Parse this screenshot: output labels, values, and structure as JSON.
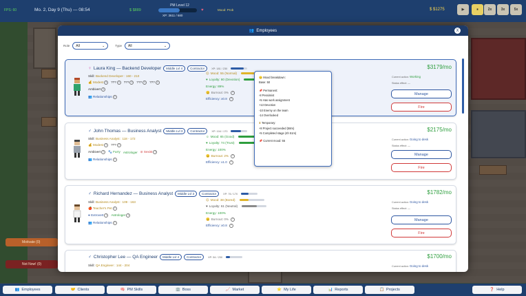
{
  "topbar": {
    "fps": "FPS: 60",
    "date": "Mo. 2, Day 9 (Thu) — 08:54",
    "money_left": "$ $889",
    "pm_level": "PM Level 12",
    "xp": "XP: 3611 / 680",
    "mood_label": "Mood: Prob",
    "balance": "$ $1275",
    "controls": [
      "▶",
      "⏸",
      "2x",
      "3x",
      "5x"
    ]
  },
  "modal": {
    "title": "Employees",
    "close": "X",
    "filters": {
      "role_label": "Role",
      "role_value": "All",
      "type_label": "Type",
      "type_value": "All"
    }
  },
  "employees": [
    {
      "name": "Laura King — Backend Developer",
      "level": "Middle Lvl 4",
      "contract": "Contractor",
      "xp": "XP: 181 / 230",
      "xp_ratio": 0.78,
      "skill_label": "Skill:",
      "skill": "Backend Developer : 160 - 210",
      "traits": [
        "Modest",
        "???",
        "???",
        "???",
        "???"
      ],
      "trait2": "Ambivert",
      "relationships": "Relationships",
      "mood": "Mood: 55 (Normal)",
      "mood_ratio": 0.55,
      "loyalty": "Loyalty: 80 (Devotion)",
      "loyalty_ratio": 0.8,
      "energy": "Energy: 89%",
      "burnout": "Burnout: 0%",
      "efficiency": "Efficiency: x0.8",
      "price": "$3179/mo",
      "current_action_label": "Current action:",
      "current_action": "Working",
      "status_effect": "Status effect: —",
      "manage": "Manage",
      "fire": "Fire"
    },
    {
      "name": "John Thomas — Business Analyst",
      "level": "Middle Lvl 3",
      "contract": "Contractor",
      "xp": "XP: 104 / 170",
      "xp_ratio": 0.61,
      "skill_label": "Skill:",
      "skill": "Business Analyst : 118 - 172",
      "traits": [
        "Modest",
        "???",
        "Furry",
        "Astrologer",
        "Sexist"
      ],
      "trait2": "Ambivert",
      "relationships": "Relationships",
      "mood": "Mood: 65 (Good)",
      "mood_ratio": 0.65,
      "loyalty": "Loyalty: 74 (Trust)",
      "loyalty_ratio": 0.74,
      "energy": "Energy: 100%",
      "burnout": "Burnout: 2%",
      "efficiency": "Efficiency: x1.0",
      "price": "$2175/mo",
      "current_action_label": "Current action:",
      "current_action": "Going to desk",
      "status_effect": "Status effect: —",
      "manage": "Manage",
      "fire": "Fire"
    },
    {
      "name": "Richard Hernandez — Business Analyst",
      "level": "Middle Lvl 3",
      "contract": "Contractor",
      "xp": "XP: 76 / 170",
      "xp_ratio": 0.45,
      "skill_label": "Skill:",
      "skill": "Business Analyst : 109 - 163",
      "traits": [
        "Teacher's Pet"
      ],
      "trait2": "Extrovert",
      "trait3": "Astrologer",
      "relationships": "Relationships",
      "mood": "Mood: 38 (Bored)",
      "mood_ratio": 0.38,
      "loyalty": "Loyalty: 61 (Neutral)",
      "loyalty_ratio": 0.61,
      "energy": "Energy: 100%",
      "burnout": "Burnout: 0%",
      "efficiency": "Efficiency: x0.8",
      "price": "$1782/mo",
      "current_action_label": "Current action:",
      "current_action": "Going to desk",
      "status_effect": "Status effect: —",
      "manage": "Manage",
      "fire": "Fire"
    },
    {
      "name": "Christopher Lee — QA Engineer",
      "level": "Middle Lvl 4",
      "contract": "Contractor",
      "xp": "XP: 54 / 230",
      "xp_ratio": 0.23,
      "skill_label": "Skill:",
      "skill": "QA Engineer : 144 - 204",
      "price": "$1700/mo",
      "current_action_label": "Current action:",
      "current_action": "Going to desk"
    }
  ],
  "tooltip": {
    "title": "Mood breakdown:",
    "base": "Base: 50",
    "permanent_title": "Permanent:",
    "permanent": [
      "-8  Pessimist",
      "+5  Has work assignment",
      "+13  Devotion",
      "-10  Enemy on the team",
      "-14  Overlooked"
    ],
    "temporary_title": "Temporary:",
    "temporary": [
      "+8  Project succeeded (58m)",
      "+5  Completed stage (4h 51m)"
    ],
    "current": "Current mood: 55"
  },
  "side_buttons": {
    "motivate": "Motivate (0)",
    "not_now": "Not Now! (0)"
  },
  "bottom_nav": [
    "Employees",
    "Clients",
    "PM Skills",
    "Boss",
    "Market",
    "My Life",
    "Reports",
    "Projects",
    "Help"
  ],
  "colors": {
    "navy": "#1d3a68",
    "green": "#2e9e3e",
    "red": "#d03838",
    "gold": "#b58a1a"
  }
}
